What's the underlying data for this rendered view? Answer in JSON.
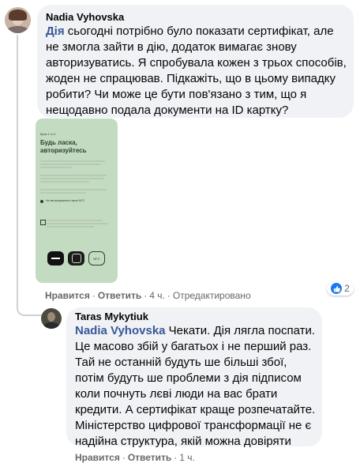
{
  "comment1": {
    "author": "Nadia Vyhovska",
    "tag": "Дія",
    "text": " сьогодні потрібно було показати сертифікат, але не змогла зайти в дію, додаток вимагає знову авторизуватись. Я спробувала кожен з трьох способів, жоден не спрацював. Підкажіть, що в цьому випадку робити? Чи може це бути пов'язано з тим, що я нещодавно подала документи на ID картку?",
    "reaction_count": "2",
    "like_label": "Нравится",
    "reply_label": "Ответить",
    "time": "4 ч.",
    "edited": "Отредактировано"
  },
  "attachment": {
    "step": "Крок 1 із 3",
    "title_line1": "Будь ласка,",
    "title_line2": "авторизуйтесь",
    "nfc_option": "Не авторизуватися через NFC",
    "nfc_button": "NFC"
  },
  "reply": {
    "author": "Taras Mykytiuk",
    "tag": "Nadia Vyhovska",
    "text": " Чекати. Дія лягла поспати. Це масово збій у багатьох і не перший раз. Тай не останній будуть ше більші збої, потім будуть ше проблеми з дія підписом коли почнуть лєві люди на вас брати кредити. А сертифікат краще розпечатайте. Міністерство цифрової трансформації не є надійна структура, якій можна довіряти",
    "like_label": "Нравится",
    "reply_label": "Ответить",
    "time": "1 ч."
  },
  "colors": {
    "bubble": "#f0f2f5",
    "accent": "#385898",
    "phone_bg": "#c3dbc1",
    "like_blue": "#1877f2"
  }
}
